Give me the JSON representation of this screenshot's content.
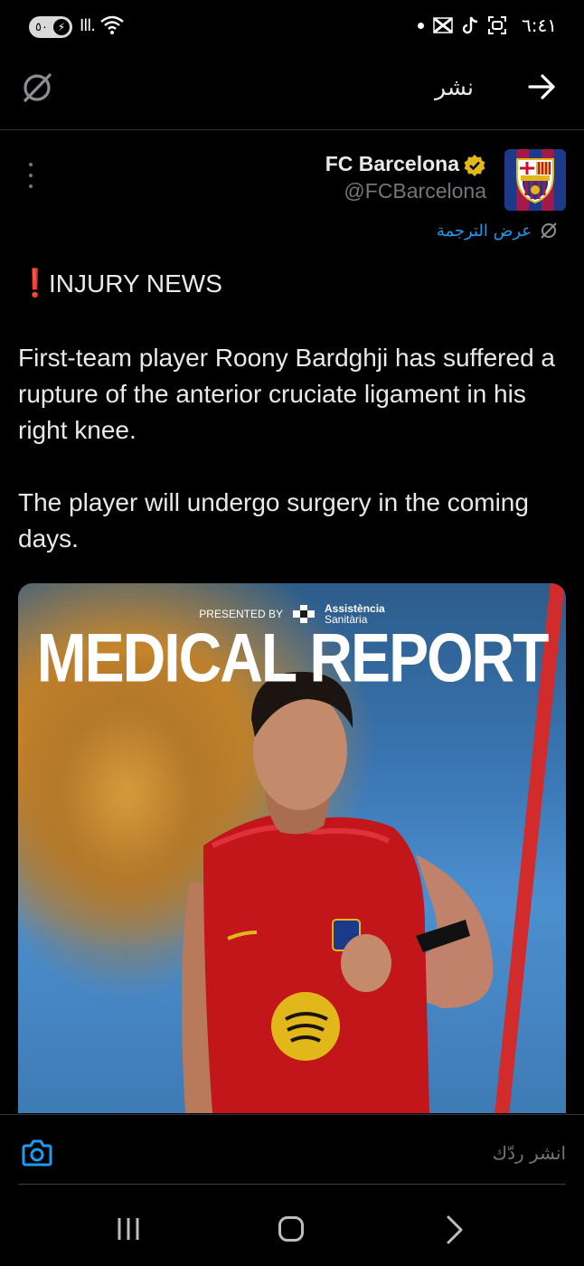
{
  "status_bar": {
    "battery": "٥٠",
    "time": "٦:٤١",
    "wifi_badge": "5"
  },
  "app_bar": {
    "title": "نشر"
  },
  "tweet": {
    "display_name": "FC Barcelona",
    "handle": "@FCBarcelona",
    "translate_label": "عرض الترجمة",
    "headline_emoji": "❗",
    "headline": "INJURY NEWS",
    "paragraph_1": "First-team player Roony Bardghji has suffered a rupture of the anterior cruciate ligament in his right knee.",
    "paragraph_2": "The player will undergo surgery in the coming days."
  },
  "media": {
    "presented_by": "PRESENTED BY",
    "sponsor_name": "Assistència",
    "sponsor_sub": "Sanitària",
    "title": "MEDICAL REPORT"
  },
  "reply": {
    "placeholder": "انشر ردّك"
  },
  "colors": {
    "accent": "#1d9bf0",
    "verified_gold": "#e2b719",
    "background": "#000000",
    "text_secondary": "#71767b"
  },
  "icons": [
    "translate-icon",
    "back-arrow-icon",
    "more-icon",
    "verified-badge-icon",
    "camera-icon",
    "recent-apps-icon",
    "home-icon",
    "nav-back-icon"
  ]
}
